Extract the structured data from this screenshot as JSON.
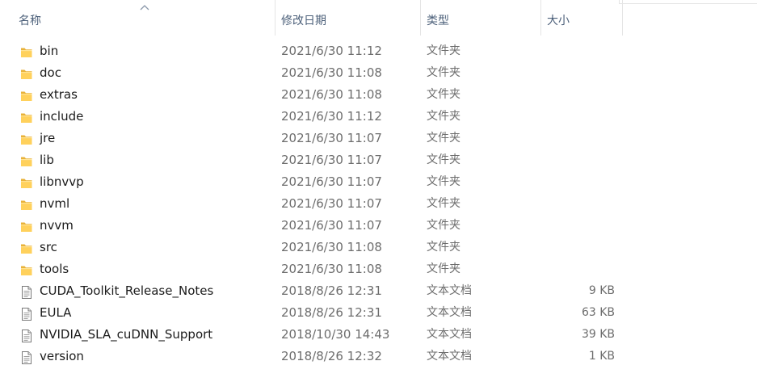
{
  "header": {
    "col_name": "名称",
    "col_date": "修改日期",
    "col_type": "类型",
    "col_size": "大小"
  },
  "colors": {
    "folder": "#ffd15c",
    "folder_dark": "#e8b23a",
    "header_text": "#4c607a",
    "secondary_text": "#6d6d6d"
  },
  "files": [
    {
      "name": "bin",
      "date": "2021/6/30 11:12",
      "type": "文件夹",
      "size": "",
      "icon": "folder-icon"
    },
    {
      "name": "doc",
      "date": "2021/6/30 11:08",
      "type": "文件夹",
      "size": "",
      "icon": "folder-icon"
    },
    {
      "name": "extras",
      "date": "2021/6/30 11:08",
      "type": "文件夹",
      "size": "",
      "icon": "folder-icon"
    },
    {
      "name": "include",
      "date": "2021/6/30 11:12",
      "type": "文件夹",
      "size": "",
      "icon": "folder-icon"
    },
    {
      "name": "jre",
      "date": "2021/6/30 11:07",
      "type": "文件夹",
      "size": "",
      "icon": "folder-icon"
    },
    {
      "name": "lib",
      "date": "2021/6/30 11:07",
      "type": "文件夹",
      "size": "",
      "icon": "folder-icon"
    },
    {
      "name": "libnvvp",
      "date": "2021/6/30 11:07",
      "type": "文件夹",
      "size": "",
      "icon": "folder-icon"
    },
    {
      "name": "nvml",
      "date": "2021/6/30 11:07",
      "type": "文件夹",
      "size": "",
      "icon": "folder-icon"
    },
    {
      "name": "nvvm",
      "date": "2021/6/30 11:07",
      "type": "文件夹",
      "size": "",
      "icon": "folder-icon"
    },
    {
      "name": "src",
      "date": "2021/6/30 11:08",
      "type": "文件夹",
      "size": "",
      "icon": "folder-icon"
    },
    {
      "name": "tools",
      "date": "2021/6/30 11:08",
      "type": "文件夹",
      "size": "",
      "icon": "folder-icon"
    },
    {
      "name": "CUDA_Toolkit_Release_Notes",
      "date": "2018/8/26 12:31",
      "type": "文本文档",
      "size": "9 KB",
      "icon": "text-document-icon"
    },
    {
      "name": "EULA",
      "date": "2018/8/26 12:31",
      "type": "文本文档",
      "size": "63 KB",
      "icon": "text-document-icon"
    },
    {
      "name": "NVIDIA_SLA_cuDNN_Support",
      "date": "2018/10/30 14:43",
      "type": "文本文档",
      "size": "39 KB",
      "icon": "text-document-icon"
    },
    {
      "name": "version",
      "date": "2018/8/26 12:32",
      "type": "文本文档",
      "size": "1 KB",
      "icon": "text-document-icon"
    }
  ]
}
